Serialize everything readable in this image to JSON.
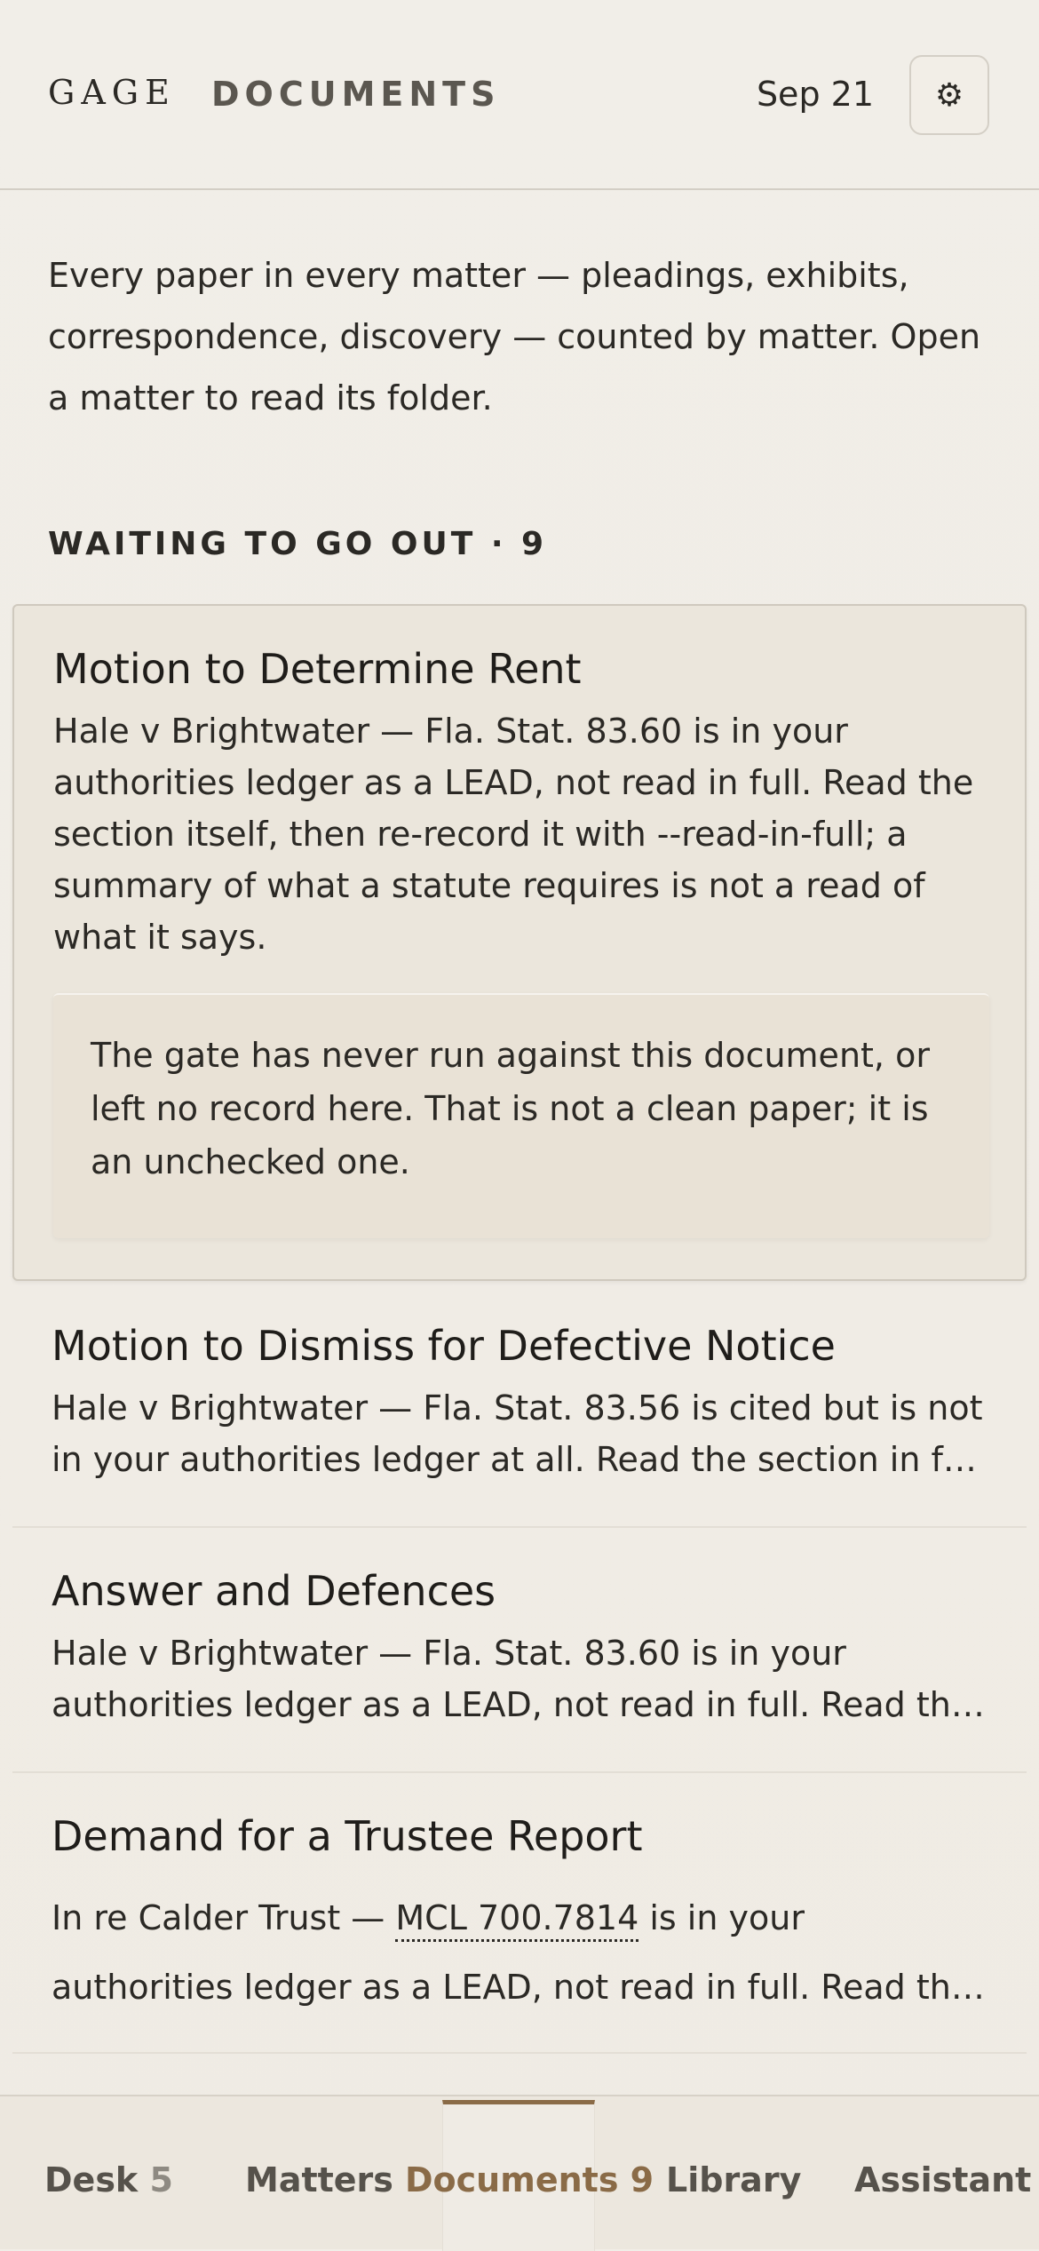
{
  "header": {
    "brand": "GAGE",
    "section": "DOCUMENTS",
    "date": "Sep 21",
    "settings_icon": "gear-icon"
  },
  "intro": "Every paper in every matter — pleadings, exhibits, correspondence, discovery — counted by matter. Open a matter to read its folder.",
  "group": {
    "label": "WAITING TO GO OUT · 9"
  },
  "documents": [
    {
      "title": "Motion to Determine Rent",
      "description": "Hale v Brightwater — Fla. Stat. 83.60 is in your authorities ledger as a LEAD, not read in full. Read the section itself, then re-record it with --read-in-full; a summary of what a statute requires is not a read of what it says.",
      "notice": "The gate has never run against this document, or left no record here. That is not a clean paper; it is an unchecked one."
    },
    {
      "title": "Motion to Dismiss for Defective Notice",
      "description_line1": "Hale v Brightwater — Fla. Stat. 83.56 is cited but is not",
      "description_line2": "in your authorities ledger at all. Read the section in full before relying on it."
    },
    {
      "title": "Answer and Defences",
      "description_line1": "Hale v Brightwater — Fla. Stat. 83.60 is in your",
      "description_line2": "authorities ledger as a LEAD, not read in full. Read the section itself."
    },
    {
      "title": "Demand for a Trustee Report",
      "description_prefix": "In re Calder Trust — ",
      "citation": "MCL 700.7814",
      "description_suffix": " is in your",
      "description_line2": "authorities ledger as a LEAD, not read in full. Read the section itself."
    }
  ],
  "nav": {
    "items": [
      {
        "label": "Desk",
        "count": "5"
      },
      {
        "label": "Matters",
        "count": ""
      },
      {
        "label": "Documents",
        "count": "9"
      },
      {
        "label": "Library",
        "count": ""
      },
      {
        "label": "Assistant",
        "count": ""
      }
    ],
    "active": "Documents",
    "accent": "#8a6b47"
  }
}
